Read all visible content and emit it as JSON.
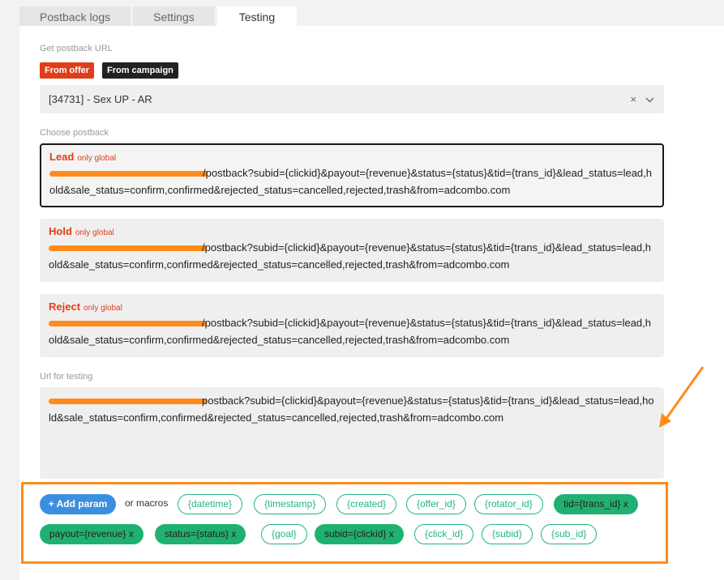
{
  "tabs": [
    {
      "label": "Postback logs"
    },
    {
      "label": "Settings"
    },
    {
      "label": "Testing"
    }
  ],
  "get_url": {
    "label": "Get postback URL",
    "from_offer": "From offer",
    "from_campaign": "From campaign",
    "from_offer_color": "#e03e1a",
    "from_campaign_color": "#222222"
  },
  "select": {
    "value": "[34731] - Sex UP - AR",
    "clear": "×",
    "chevron": "⌵"
  },
  "choose_label": "Choose postback",
  "postbacks": [
    {
      "name": "Lead",
      "note": "only global",
      "url": "/postback?subid={clickid}&payout={revenue}&status={status}&tid={trans_id}&lead_status=lead,hold&sale_status=confirm,confirmed&rejected_status=cancelled,rejected,trash&from=adcombo.com"
    },
    {
      "name": "Hold",
      "note": "only global",
      "url": "/postback?subid={clickid}&payout={revenue}&status={status}&tid={trans_id}&lead_status=lead,hold&sale_status=confirm,confirmed&rejected_status=cancelled,rejected,trash&from=adcombo.com"
    },
    {
      "name": "Reject",
      "note": "only global",
      "url": "/postback?subid={clickid}&payout={revenue}&status={status}&tid={trans_id}&lead_status=lead,hold&sale_status=confirm,confirmed&rejected_status=cancelled,rejected,trash&from=adcombo.com"
    }
  ],
  "test": {
    "label": "Url for testing",
    "url": "postback?subid={clickid}&payout={revenue}&status={status}&tid={trans_id}&lead_status=lead,hold&sale_status=confirm,confirmed&rejected_status=cancelled,rejected,trash&from=adcombo.com"
  },
  "params": {
    "add_label": "+ Add param",
    "or_macros": "or macros",
    "chips_row1": [
      {
        "label": "{datetime}",
        "active": false
      },
      {
        "label": "{timestamp}",
        "active": false
      },
      {
        "label": "{created}",
        "active": false
      },
      {
        "label": "{offer_id}",
        "active": false
      },
      {
        "label": "{rotator_id}",
        "active": false
      },
      {
        "label": "tid={trans_id} x",
        "active": true
      }
    ],
    "chips_row2": [
      {
        "label": "payout={revenue} x",
        "active": true
      },
      {
        "label": "status={status} x",
        "active": true
      },
      {
        "label": "{goal}",
        "active": false
      },
      {
        "label": "subid={clickid} x",
        "active": true
      },
      {
        "label": "{click_id}",
        "active": false
      },
      {
        "label": "{subid}",
        "active": false
      },
      {
        "label": "{sub_id}",
        "active": false
      }
    ]
  },
  "colors": {
    "accent_orange": "#ff8c1a",
    "chip_green": "#1fb172",
    "button_blue": "#3b8fe0"
  }
}
